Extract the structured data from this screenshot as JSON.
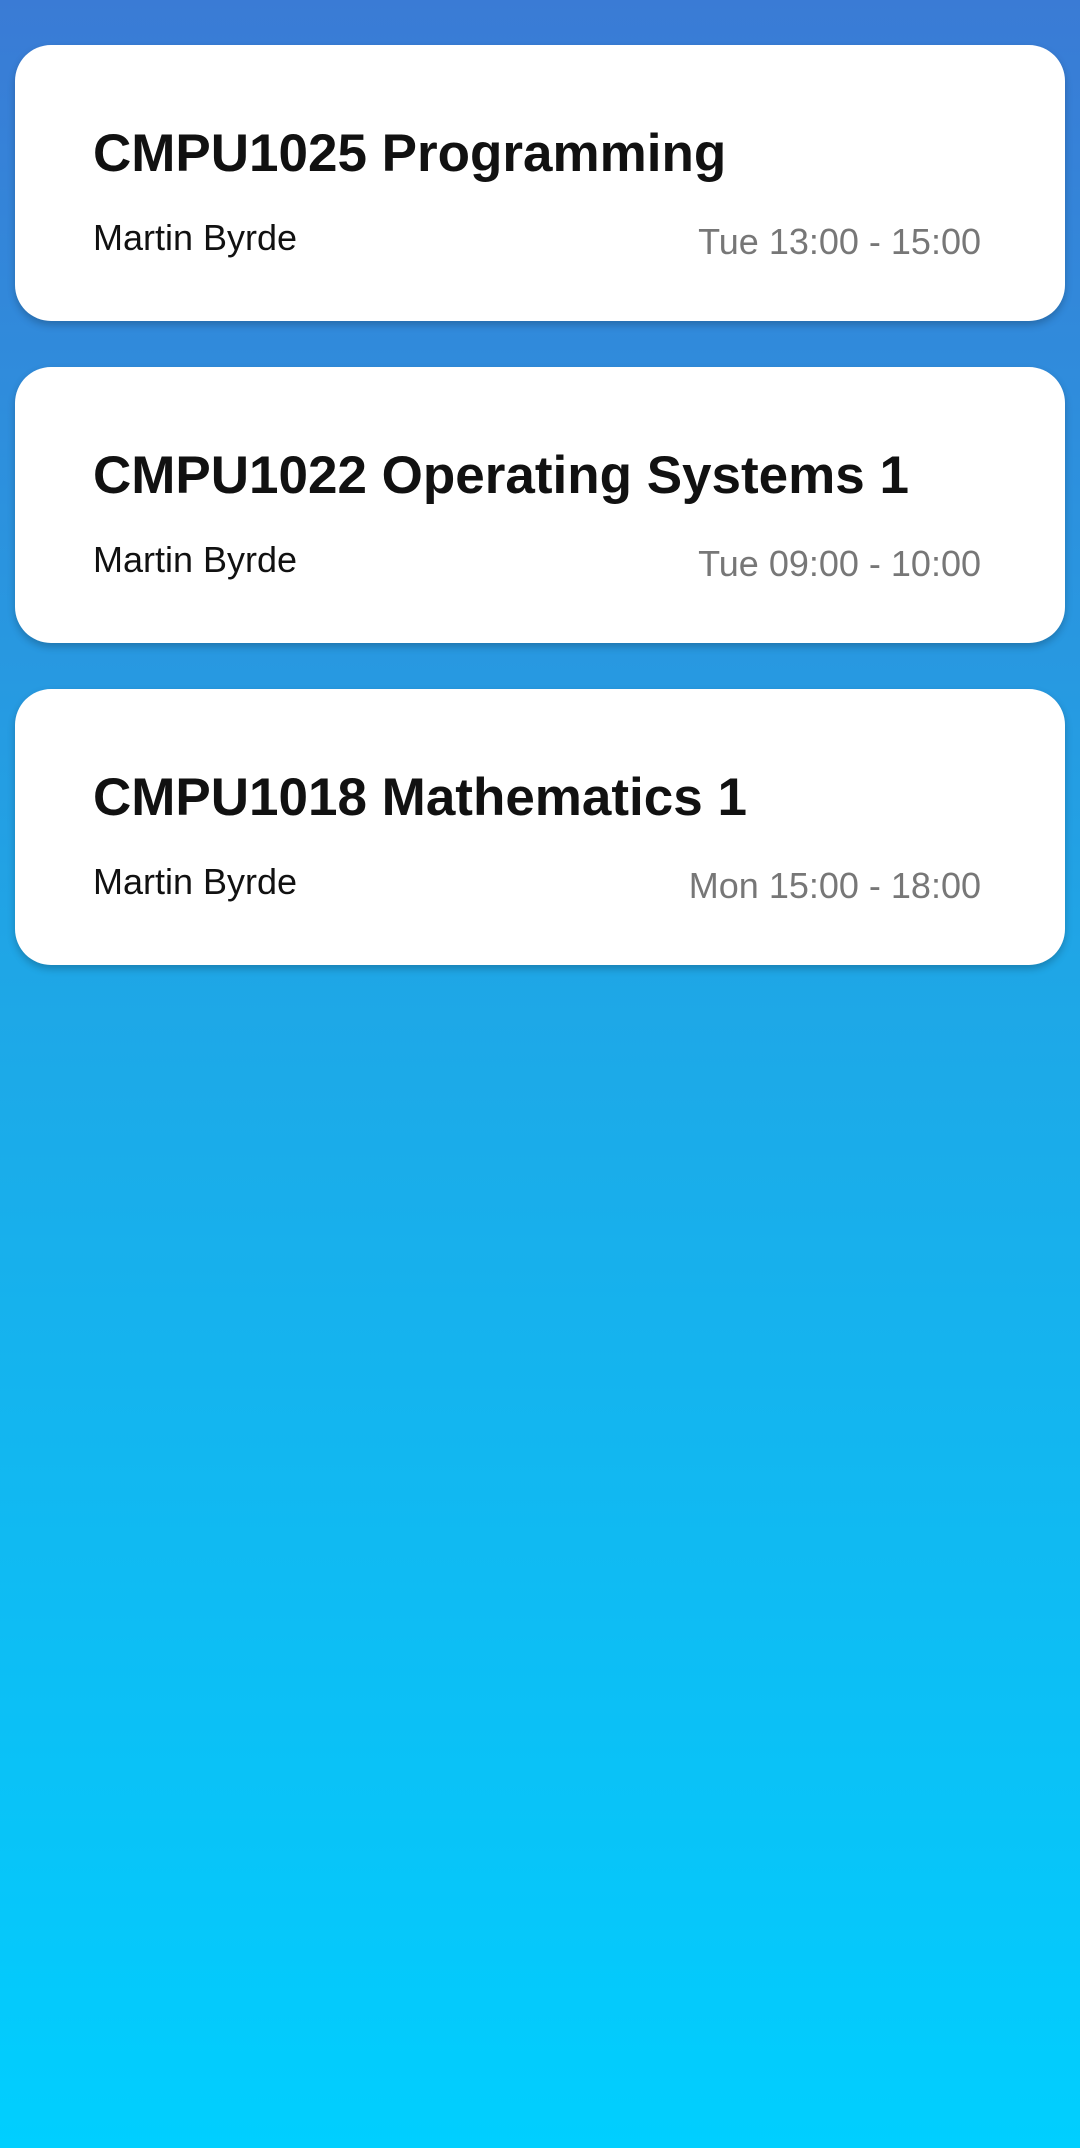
{
  "courses": [
    {
      "title": "CMPU1025 Programming",
      "lecturer": "Martin Byrde",
      "time": "Tue 13:00 - 15:00"
    },
    {
      "title": "CMPU1022 Operating Systems 1",
      "lecturer": "Martin Byrde",
      "time": "Tue 09:00 - 10:00"
    },
    {
      "title": "CMPU1018 Mathematics 1",
      "lecturer": "Martin Byrde",
      "time": "Mon 15:00 - 18:00"
    }
  ],
  "colors": {
    "gradient_top": "#3a7bd5",
    "gradient_bottom": "#00cfff",
    "card_background": "#ffffff",
    "title_text": "#111111",
    "time_text": "#777777"
  }
}
